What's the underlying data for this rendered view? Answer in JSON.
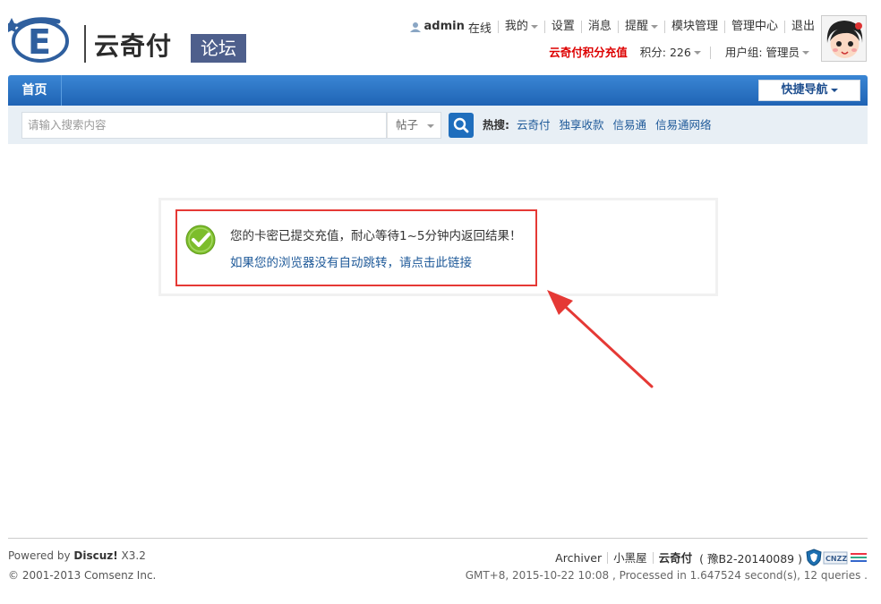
{
  "logo": {
    "name": "云奇付",
    "sub": "论坛"
  },
  "topnav": {
    "username": "admin",
    "status": "在线",
    "items": [
      "我的",
      "设置",
      "消息",
      "提醒",
      "模块管理",
      "管理中心",
      "退出"
    ]
  },
  "userbar": {
    "recharge": "云奇付积分充值",
    "credits": "积分: 226",
    "group": "用户组: 管理员"
  },
  "navbar": {
    "home": "首页",
    "quick_nav": "快捷导航"
  },
  "search": {
    "placeholder": "请输入搜索内容",
    "type": "帖子",
    "hot_label": "热搜:",
    "hot_terms": [
      "云奇付",
      "独享收款",
      "信易通",
      "信易通网络"
    ]
  },
  "message": {
    "line1": "您的卡密已提交充值，耐心等待1~5分钟内返回结果！",
    "link": "如果您的浏览器没有自动跳转，请点击此链接"
  },
  "footer": {
    "powered_prefix": "Powered by ",
    "powered_brand": "Discuz!",
    "powered_version": " X3.2",
    "copyright": "© 2001-2013 Comsenz Inc.",
    "links": [
      "Archiver",
      "小黑屋",
      "云奇付"
    ],
    "icp": "( 豫B2-20140089 )",
    "stats": "GMT+8, 2015-10-22 10:08 , Processed in 1.647524 second(s), 12 queries ."
  },
  "colors": {
    "nav_blue": "#2a74c6",
    "recharge_red": "#dd0000",
    "link_blue": "#1f5a99",
    "highlight_red": "#e53935",
    "success_green": "#7cbd2b"
  }
}
